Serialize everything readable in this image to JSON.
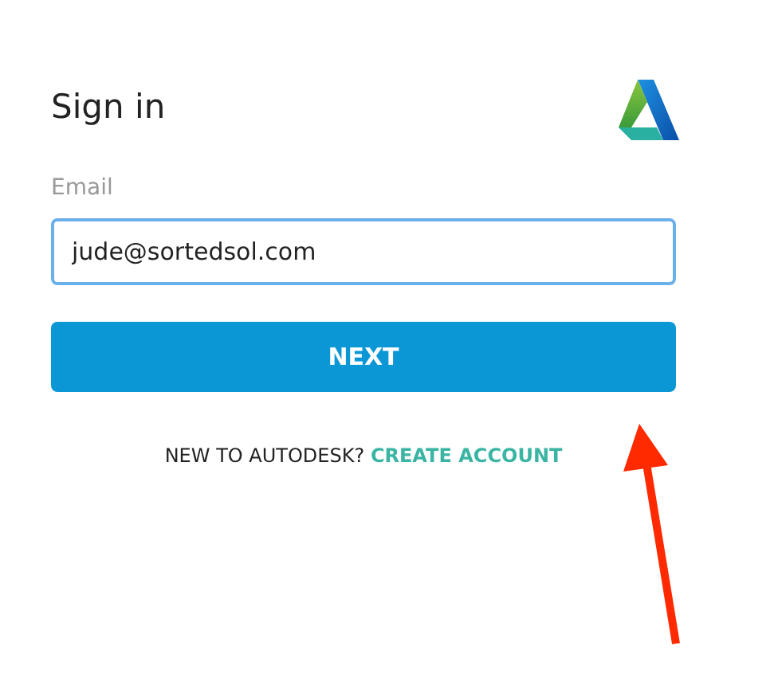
{
  "title": "Sign in",
  "email": {
    "label": "Email",
    "value": "jude@sortedsol.com"
  },
  "next_button": "NEXT",
  "signup": {
    "prompt": "NEW TO AUTODESK?",
    "link": "CREATE ACCOUNT"
  }
}
